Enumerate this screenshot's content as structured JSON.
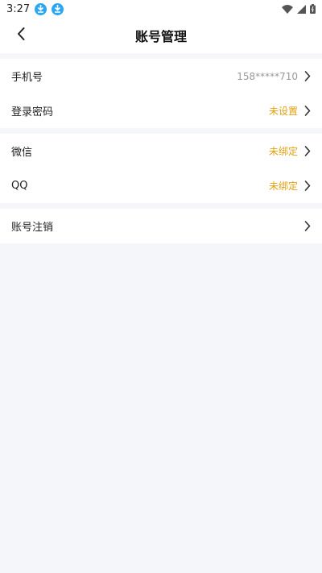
{
  "status_bar": {
    "time": "3:27",
    "icons": [
      "download-icon",
      "download-icon",
      "wifi-icon",
      "signal-icon",
      "battery-icon"
    ]
  },
  "header": {
    "title": "账号管理",
    "back_icon": "chevron-left-icon"
  },
  "groups": [
    {
      "rows": [
        {
          "label": "手机号",
          "value": "158*****710",
          "value_color": "#999999"
        },
        {
          "label": "登录密码",
          "value": "未设置",
          "value_color": "#e3a010"
        }
      ]
    },
    {
      "rows": [
        {
          "label": "微信",
          "value": "未绑定",
          "value_color": "#e3a010"
        },
        {
          "label": "QQ",
          "value": "未绑定",
          "value_color": "#e3a010"
        }
      ]
    },
    {
      "rows": [
        {
          "label": "账号注销",
          "value": ""
        }
      ]
    }
  ],
  "colors": {
    "page_background": "#f5f6fa",
    "accent_orange": "#e3a010",
    "muted_gray": "#999999",
    "download_badge": "#2aa7f0"
  }
}
